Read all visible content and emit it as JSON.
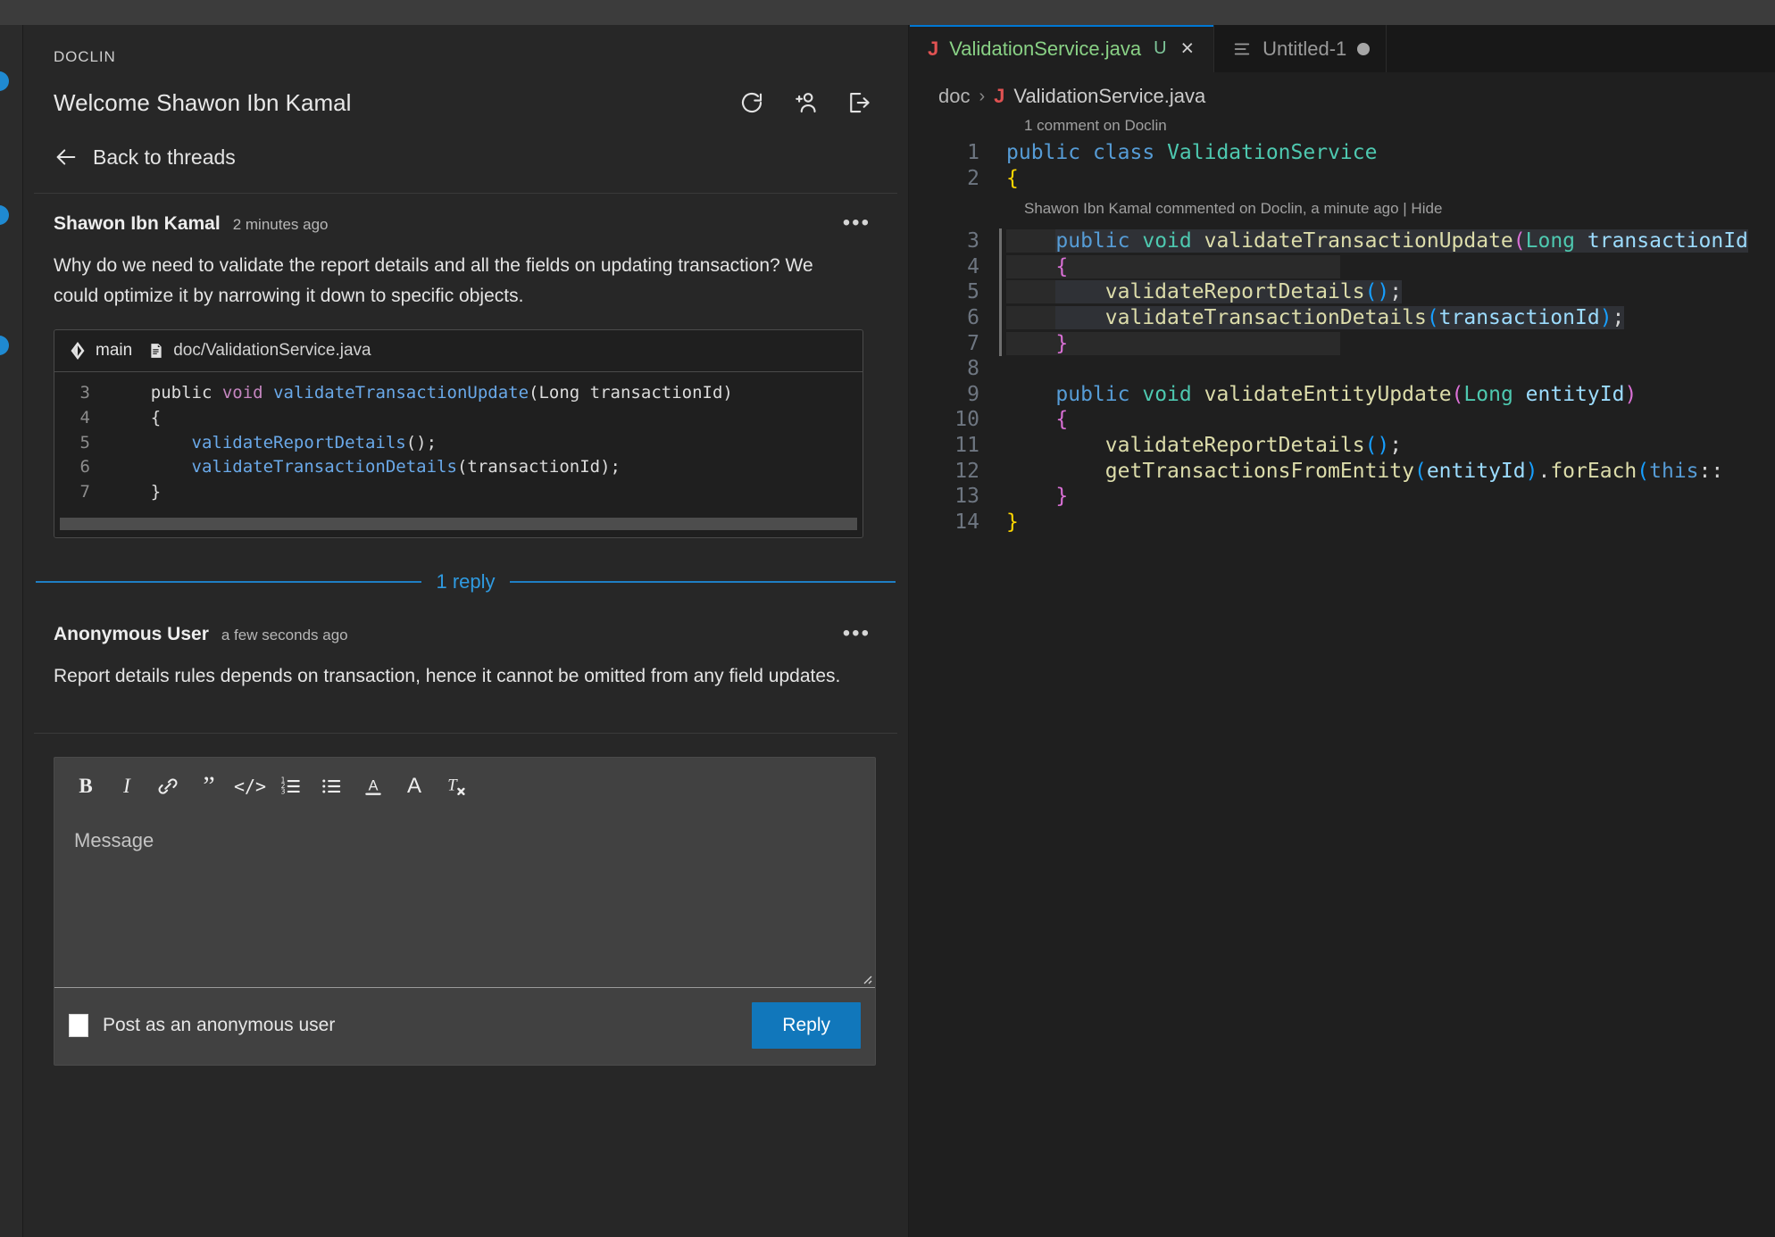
{
  "sidebar": {
    "section_title": "DOCLIN",
    "welcome": "Welcome Shawon Ibn Kamal",
    "actions": [
      {
        "name": "refresh-icon",
        "label": "Refresh"
      },
      {
        "name": "add-person-icon",
        "label": "Invite user"
      },
      {
        "name": "sign-out-icon",
        "label": "Sign out"
      }
    ],
    "back_label": "Back to threads",
    "thread": {
      "author": "Shawon Ibn Kamal",
      "time": "2 minutes ago",
      "menu": "•••",
      "body": "Why do we need to validate the report details and all the fields on updating transaction? We could optimize it by narrowing it down to specific objects.",
      "snippet": {
        "branch": "main",
        "path": "doc/ValidationService.java",
        "lines": [
          {
            "no": "3",
            "code": "    public void validateTransactionUpdate(Long transactionId)"
          },
          {
            "no": "4",
            "code": "    {"
          },
          {
            "no": "5",
            "code": "        validateReportDetails();"
          },
          {
            "no": "6",
            "code": "        validateTransactionDetails(transactionId);"
          },
          {
            "no": "7",
            "code": "    }"
          }
        ]
      }
    },
    "reply_divider_label": "1 reply",
    "reply": {
      "author": "Anonymous User",
      "time": "a few seconds ago",
      "menu": "•••",
      "body": "Report details rules depends on transaction, hence it cannot be omitted from any field updates."
    },
    "composer": {
      "toolbar": [
        {
          "name": "bold-icon",
          "label": "B"
        },
        {
          "name": "italic-icon",
          "label": "I"
        },
        {
          "name": "link-icon",
          "label": "Link"
        },
        {
          "name": "blockquote-icon",
          "label": "”"
        },
        {
          "name": "code-icon",
          "label": "</>"
        },
        {
          "name": "ordered-list-icon",
          "label": "Ordered list"
        },
        {
          "name": "bullet-list-icon",
          "label": "Bullet list"
        },
        {
          "name": "underline-icon",
          "label": "A"
        },
        {
          "name": "text-color-icon",
          "label": "A"
        },
        {
          "name": "clear-format-icon",
          "label": "Tx"
        }
      ],
      "message_placeholder": "Message",
      "message_value": "",
      "anonymous_label": "Post as an anonymous user",
      "anonymous_checked": false,
      "submit_label": "Reply"
    }
  },
  "editor": {
    "tabs": [
      {
        "label": "ValidationService.java",
        "icon": "java-icon",
        "git_status": "U",
        "active": true,
        "dirty": false,
        "close": "×"
      },
      {
        "label": "Untitled-1",
        "icon": "text-file-icon",
        "git_status": "",
        "active": false,
        "dirty": true,
        "close": ""
      }
    ],
    "breadcrumb": {
      "folder": "doc",
      "separator": "›",
      "file": "ValidationService.java"
    },
    "comment_decoration": "1 comment on Doclin",
    "inline_decoration": "Shawon Ibn Kamal commented on Doclin, a minute ago | Hide",
    "code_lines": [
      {
        "no": "1",
        "code": "public class ValidationService",
        "highlight": false
      },
      {
        "no": "2",
        "code": "{",
        "highlight": false
      },
      {
        "no": "3",
        "code": "    public void validateTransactionUpdate(Long transactionId)",
        "highlight": true
      },
      {
        "no": "4",
        "code": "    {",
        "highlight": true
      },
      {
        "no": "5",
        "code": "        validateReportDetails();",
        "highlight": true
      },
      {
        "no": "6",
        "code": "        validateTransactionDetails(transactionId);",
        "highlight": true
      },
      {
        "no": "7",
        "code": "    }",
        "highlight": true
      },
      {
        "no": "8",
        "code": "",
        "highlight": false
      },
      {
        "no": "9",
        "code": "    public void validateEntityUpdate(Long entityId)",
        "highlight": false
      },
      {
        "no": "10",
        "code": "    {",
        "highlight": false
      },
      {
        "no": "11",
        "code": "        validateReportDetails();",
        "highlight": false
      },
      {
        "no": "12",
        "code": "        getTransactionsFromEntity(entityId).forEach(this::",
        "highlight": false
      },
      {
        "no": "13",
        "code": "    }",
        "highlight": false
      },
      {
        "no": "14",
        "code": "}",
        "highlight": false
      }
    ]
  },
  "colors": {
    "accent_blue": "#1177bb",
    "link_blue": "#2f9ae0",
    "tab_active_text": "#89d185",
    "java_icon_red": "#e05252",
    "badge_blue": "#1f8ad2"
  }
}
